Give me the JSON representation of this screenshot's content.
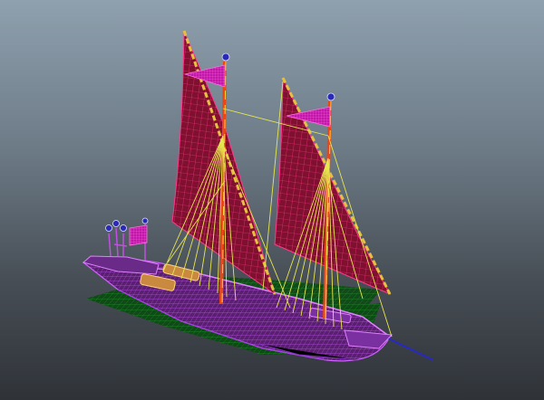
{
  "viewport": {
    "background_top": "#8fa0ae",
    "background_bottom": "#2f3338"
  },
  "model": {
    "kind": "two-masted sailing galley (wireframe)",
    "wire_colors": {
      "hull": "#b040d8",
      "sail": "#8a1030",
      "sail_wire": "#ff3a8a",
      "mast": "#e85018",
      "rigging": "#e0e040",
      "oars_deck": "#188020",
      "cargo": "#e0a050",
      "pennant": "#d020b0",
      "lantern": "#2a2ab8"
    }
  }
}
